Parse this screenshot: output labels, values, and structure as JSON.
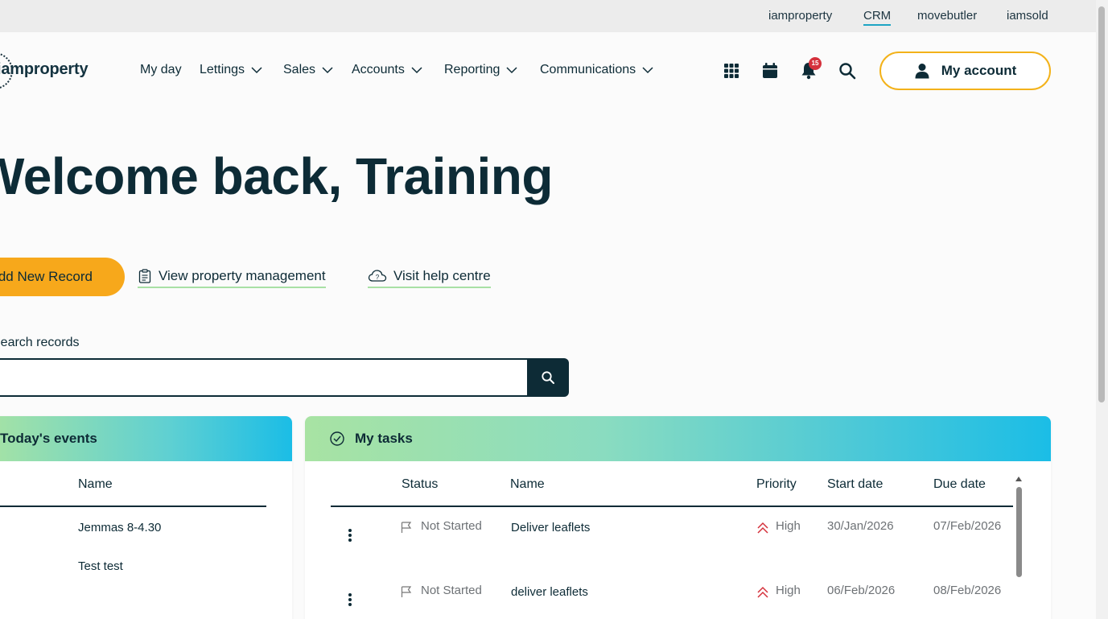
{
  "topbar": {
    "links": [
      "iamproperty",
      "CRM",
      "movebutler",
      "iamsold"
    ],
    "active": "CRM"
  },
  "header": {
    "logo_text": "iamproperty",
    "nav": [
      {
        "label": "My day",
        "has_menu": false
      },
      {
        "label": "Lettings",
        "has_menu": true
      },
      {
        "label": "Sales",
        "has_menu": true
      },
      {
        "label": "Accounts",
        "has_menu": true
      },
      {
        "label": "Reporting",
        "has_menu": true
      },
      {
        "label": "Communications",
        "has_menu": true
      }
    ],
    "icons": [
      "apps-grid-icon",
      "calendar-icon",
      "bell-icon",
      "search-icon"
    ],
    "notification_count": "15",
    "account_label": "My account"
  },
  "hero": {
    "welcome": "Welcome back, Training",
    "add_button": "Add New Record",
    "link_property": "View property management",
    "link_help": "Visit help centre"
  },
  "search": {
    "label": "Search records",
    "placeholder": ""
  },
  "events": {
    "title": "Today's events",
    "column_name": "Name",
    "rows": [
      "Jemmas 8-4.30",
      "Test test"
    ]
  },
  "tasks": {
    "title": "My tasks",
    "columns": {
      "status": "Status",
      "name": "Name",
      "priority": "Priority",
      "start": "Start date",
      "due": "Due date"
    },
    "rows": [
      {
        "status": "Not Started",
        "name": "Deliver leaflets",
        "priority": "High",
        "start": "30/Jan/2026",
        "due": "07/Feb/2026"
      },
      {
        "status": "Not Started",
        "name": "deliver leaflets",
        "priority": "High",
        "start": "06/Feb/2026",
        "due": "08/Feb/2026"
      }
    ]
  },
  "colors": {
    "primary": "#0d2b36",
    "accent_orange": "#f7a81b",
    "account_border": "#f3b21a",
    "badge": "#d5313c",
    "priority_high": "#d5313c"
  }
}
